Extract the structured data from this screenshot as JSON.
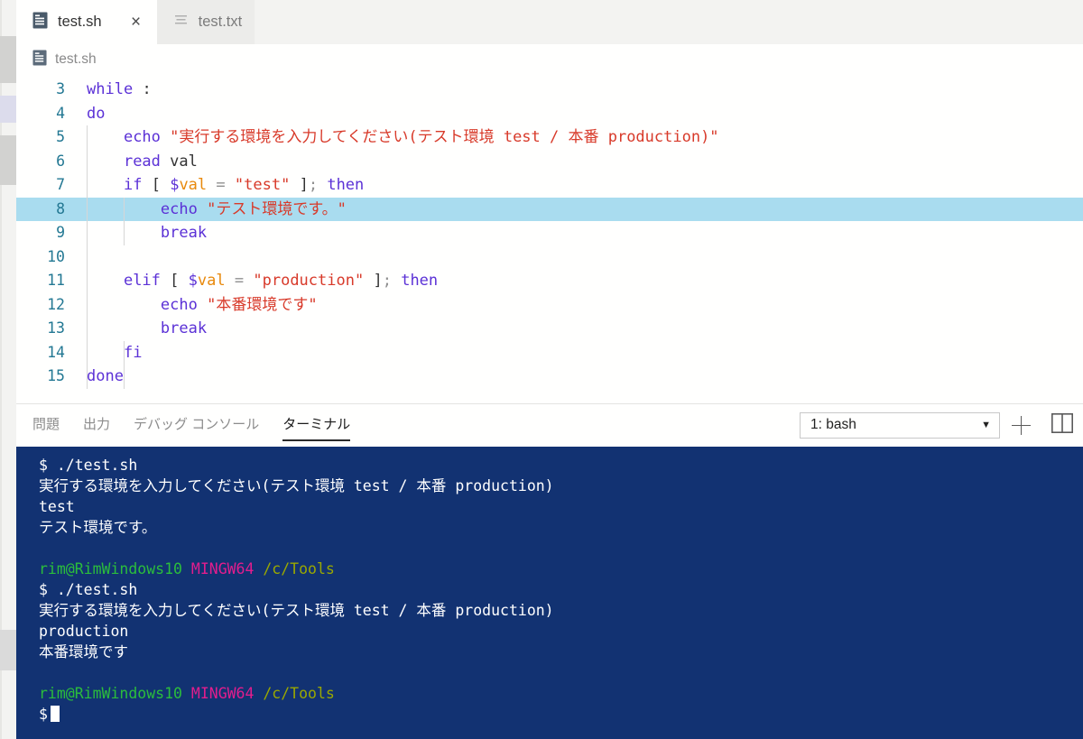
{
  "window": {
    "tabs": [
      {
        "label": "test.sh",
        "icon": "script-file-icon",
        "active": true,
        "closable": true,
        "close_glyph": "×"
      },
      {
        "label": "test.txt",
        "icon": "text-file-icon",
        "active": false,
        "closable": false,
        "close_glyph": ""
      }
    ]
  },
  "breadcrumb": {
    "icon": "script-file-icon",
    "label": "test.sh"
  },
  "editor": {
    "language": "shellscript",
    "highlighted_line": 8,
    "lines": [
      {
        "num": "3",
        "tokens": [
          {
            "t": "while",
            "c": "kw"
          },
          {
            "t": " ",
            "c": "plain"
          },
          {
            "t": ":",
            "c": "plain"
          }
        ]
      },
      {
        "num": "4",
        "tokens": [
          {
            "t": "do",
            "c": "kw"
          }
        ]
      },
      {
        "num": "5",
        "tokens": [
          {
            "t": "    ",
            "c": "plain"
          },
          {
            "t": "echo",
            "c": "kw"
          },
          {
            "t": " ",
            "c": "plain"
          },
          {
            "t": "\"実行する環境を入力してください(テスト環境 test / 本番 production)\"",
            "c": "str"
          }
        ]
      },
      {
        "num": "6",
        "tokens": [
          {
            "t": "    ",
            "c": "plain"
          },
          {
            "t": "read",
            "c": "kw"
          },
          {
            "t": " val",
            "c": "plain"
          }
        ]
      },
      {
        "num": "7",
        "tokens": [
          {
            "t": "    ",
            "c": "plain"
          },
          {
            "t": "if",
            "c": "kw"
          },
          {
            "t": " ",
            "c": "plain"
          },
          {
            "t": "[",
            "c": "brk"
          },
          {
            "t": " ",
            "c": "plain"
          },
          {
            "t": "$",
            "c": "varsym"
          },
          {
            "t": "val",
            "c": "var"
          },
          {
            "t": " ",
            "c": "plain"
          },
          {
            "t": "=",
            "c": "op"
          },
          {
            "t": " ",
            "c": "plain"
          },
          {
            "t": "\"test\"",
            "c": "str"
          },
          {
            "t": " ",
            "c": "plain"
          },
          {
            "t": "]",
            "c": "brk"
          },
          {
            "t": ";",
            "c": "op"
          },
          {
            "t": " ",
            "c": "plain"
          },
          {
            "t": "then",
            "c": "kw"
          }
        ]
      },
      {
        "num": "8",
        "tokens": [
          {
            "t": "        ",
            "c": "plain"
          },
          {
            "t": "echo",
            "c": "kw"
          },
          {
            "t": " ",
            "c": "plain"
          },
          {
            "t": "\"テスト環境です。\"",
            "c": "str"
          }
        ]
      },
      {
        "num": "9",
        "tokens": [
          {
            "t": "        ",
            "c": "plain"
          },
          {
            "t": "break",
            "c": "kw"
          }
        ]
      },
      {
        "num": "10",
        "tokens": []
      },
      {
        "num": "11",
        "tokens": [
          {
            "t": "    ",
            "c": "plain"
          },
          {
            "t": "elif",
            "c": "kw"
          },
          {
            "t": " ",
            "c": "plain"
          },
          {
            "t": "[",
            "c": "brk"
          },
          {
            "t": " ",
            "c": "plain"
          },
          {
            "t": "$",
            "c": "varsym"
          },
          {
            "t": "val",
            "c": "var"
          },
          {
            "t": " ",
            "c": "plain"
          },
          {
            "t": "=",
            "c": "op"
          },
          {
            "t": " ",
            "c": "plain"
          },
          {
            "t": "\"production\"",
            "c": "str"
          },
          {
            "t": " ",
            "c": "plain"
          },
          {
            "t": "]",
            "c": "brk"
          },
          {
            "t": ";",
            "c": "op"
          },
          {
            "t": " ",
            "c": "plain"
          },
          {
            "t": "then",
            "c": "kw"
          }
        ]
      },
      {
        "num": "12",
        "tokens": [
          {
            "t": "        ",
            "c": "plain"
          },
          {
            "t": "echo",
            "c": "kw"
          },
          {
            "t": " ",
            "c": "plain"
          },
          {
            "t": "\"本番環境です\"",
            "c": "str"
          }
        ]
      },
      {
        "num": "13",
        "tokens": [
          {
            "t": "        ",
            "c": "plain"
          },
          {
            "t": "break",
            "c": "kw"
          }
        ]
      },
      {
        "num": "14",
        "tokens": [
          {
            "t": "    ",
            "c": "plain"
          },
          {
            "t": "fi",
            "c": "kw"
          }
        ]
      },
      {
        "num": "15",
        "tokens": [
          {
            "t": "done",
            "c": "kw"
          }
        ]
      }
    ]
  },
  "panel": {
    "tabs": [
      {
        "label": "問題",
        "active": false
      },
      {
        "label": "出力",
        "active": false
      },
      {
        "label": "デバッグ コンソール",
        "active": false
      },
      {
        "label": "ターミナル",
        "active": true
      }
    ],
    "terminal_select": {
      "value": "1: bash",
      "caret": "▼"
    },
    "new_terminal_label": "+",
    "split_terminal_label": "split-terminal"
  },
  "terminal": {
    "lines": [
      {
        "segs": [
          {
            "t": "$ ./test.sh",
            "c": "t-white"
          }
        ]
      },
      {
        "segs": [
          {
            "t": "実行する環境を入力してください(テスト環境 test / 本番 production)",
            "c": "t-white"
          }
        ]
      },
      {
        "segs": [
          {
            "t": "test",
            "c": "t-white"
          }
        ]
      },
      {
        "segs": [
          {
            "t": "テスト環境です。",
            "c": "t-white"
          }
        ]
      },
      {
        "segs": []
      },
      {
        "segs": [
          {
            "t": "rim@RimWindows10",
            "c": "t-green"
          },
          {
            "t": " ",
            "c": "t-white"
          },
          {
            "t": "MINGW64",
            "c": "t-magenta"
          },
          {
            "t": " ",
            "c": "t-white"
          },
          {
            "t": "/c/Tools",
            "c": "t-olive"
          }
        ]
      },
      {
        "segs": [
          {
            "t": "$ ./test.sh",
            "c": "t-white"
          }
        ]
      },
      {
        "segs": [
          {
            "t": "実行する環境を入力してください(テスト環境 test / 本番 production)",
            "c": "t-white"
          }
        ]
      },
      {
        "segs": [
          {
            "t": "production",
            "c": "t-white"
          }
        ]
      },
      {
        "segs": [
          {
            "t": "本番環境です",
            "c": "t-white"
          }
        ]
      },
      {
        "segs": []
      },
      {
        "segs": [
          {
            "t": "rim@RimWindows10",
            "c": "t-green"
          },
          {
            "t": " ",
            "c": "t-white"
          },
          {
            "t": "MINGW64",
            "c": "t-magenta"
          },
          {
            "t": " ",
            "c": "t-white"
          },
          {
            "t": "/c/Tools",
            "c": "t-olive"
          }
        ]
      },
      {
        "segs": [
          {
            "t": "$",
            "c": "t-white"
          }
        ],
        "cursor": true
      }
    ]
  },
  "colors": {
    "terminal_bg": "#123272",
    "tabbar_bg": "#f3f3f1",
    "editor_bg": "#fffffe",
    "line_highlight": "#a9dcef",
    "linenumber": "#237893",
    "keyword": "#5b31d6",
    "string": "#d83a2a",
    "variable": "#e8890c",
    "prompt_green": "#2bbd3c",
    "prompt_magenta": "#e21d8d",
    "prompt_olive": "#9aa800"
  }
}
